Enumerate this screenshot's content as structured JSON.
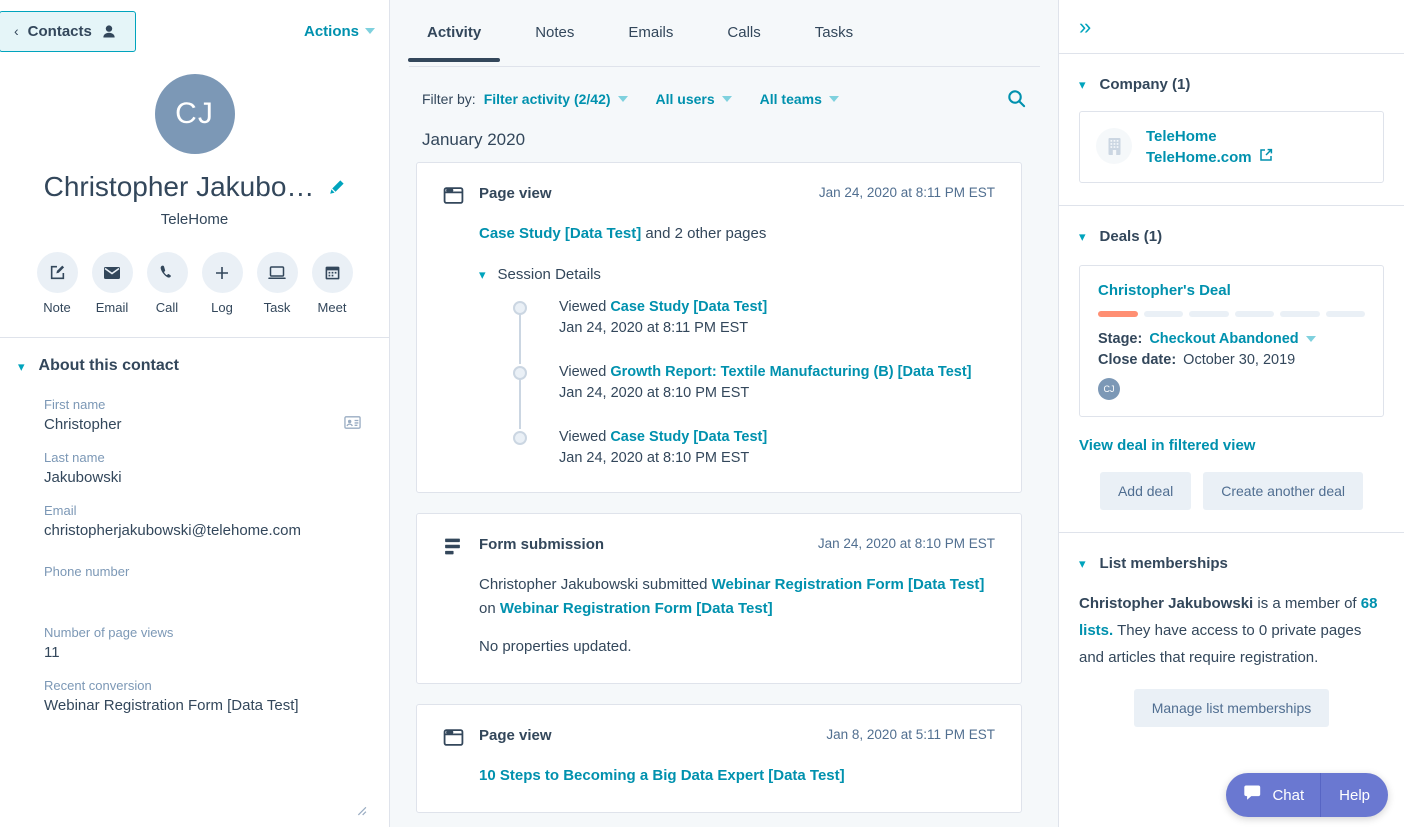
{
  "left": {
    "back_button": {
      "label": "Contacts",
      "chevron": "‹",
      "icon": "person-icon"
    },
    "actions": {
      "label": "Actions"
    },
    "profile": {
      "initials": "CJ",
      "name": "Christopher Jakubo…",
      "company": "TeleHome",
      "edit_icon": "pencil-icon"
    },
    "quick_actions": [
      {
        "label": "Note",
        "icon": "note-icon"
      },
      {
        "label": "Email",
        "icon": "email-icon"
      },
      {
        "label": "Call",
        "icon": "call-icon"
      },
      {
        "label": "Log",
        "icon": "plus-icon"
      },
      {
        "label": "Task",
        "icon": "task-icon"
      },
      {
        "label": "Meet",
        "icon": "calendar-icon"
      }
    ],
    "about": {
      "title": "About this contact",
      "properties": [
        {
          "label": "First name",
          "value": "Christopher"
        },
        {
          "label": "Last name",
          "value": "Jakubowski"
        },
        {
          "label": "Email",
          "value": "christopherjakubowski@telehome.com"
        },
        {
          "label": "Phone number",
          "value": ""
        },
        {
          "label": "Number of page views",
          "value": "11"
        },
        {
          "label": "Recent conversion",
          "value": "Webinar Registration Form [Data Test]"
        }
      ]
    }
  },
  "center": {
    "tabs": [
      {
        "label": "Activity",
        "active": true
      },
      {
        "label": "Notes",
        "active": false
      },
      {
        "label": "Emails",
        "active": false
      },
      {
        "label": "Calls",
        "active": false
      },
      {
        "label": "Tasks",
        "active": false
      }
    ],
    "filter": {
      "label": "Filter by:",
      "activity": "Filter activity (2/42)",
      "users": "All users",
      "teams": "All teams",
      "search_icon": "search-icon"
    },
    "month_heading": "January 2020",
    "cards": [
      {
        "icon": "page-view-icon",
        "title": "Page view",
        "date": "Jan 24, 2020 at 8:11 PM EST",
        "link_text": "Case Study [Data Test]",
        "trailing_text": " and 2 other pages",
        "session_toggle": "Session Details",
        "sessions": [
          {
            "prefix": "Viewed ",
            "link": "Case Study [Data Test]",
            "time": "Jan 24, 2020 at 8:11 PM EST"
          },
          {
            "prefix": "Viewed ",
            "link": "Growth Report: Textile Manufacturing (B) [Data Test]",
            "time": "Jan 24, 2020 at 8:10 PM EST"
          },
          {
            "prefix": "Viewed ",
            "link": "Case Study [Data Test]",
            "time": "Jan 24, 2020 at 8:10 PM EST"
          }
        ]
      },
      {
        "icon": "form-submission-icon",
        "title": "Form submission",
        "date": "Jan 24, 2020 at 8:10 PM EST",
        "body_prefix": "Christopher Jakubowski submitted ",
        "body_link1": "Webinar Registration Form [Data Test]",
        "body_mid": " on ",
        "body_link2": "Webinar Registration Form [Data Test]",
        "body_note": "No properties updated."
      },
      {
        "icon": "page-view-icon",
        "title": "Page view",
        "date": "Jan 8, 2020 at 5:11 PM EST",
        "link_text": "10 Steps to Becoming a Big Data Expert [Data Test]"
      }
    ]
  },
  "right": {
    "collapse_icon": "double-chevron-right-icon",
    "company": {
      "title": "Company (1)",
      "name": "TeleHome",
      "url": "TeleHome.com",
      "logo_icon": "building-icon",
      "external_icon": "external-link-icon"
    },
    "deals": {
      "title": "Deals (1)",
      "deal_name": "Christopher's Deal",
      "pipeline_total": 6,
      "pipeline_active": 1,
      "pipeline_active_color": "#ff8f73",
      "stage_label": "Stage:",
      "stage_value": "Checkout Abandoned",
      "close_label": "Close date:",
      "close_value": "October 30, 2019",
      "owner_initials": "CJ",
      "view_link": "View deal in filtered view",
      "add_button": "Add deal",
      "create_button": "Create another deal"
    },
    "lists": {
      "title": "List memberships",
      "text_name": "Christopher Jakubowski",
      "text_mid": " is a member of ",
      "text_link": "68 lists.",
      "text_tail": " They have access to 0 private pages and articles that require registration.",
      "manage_button": "Manage list memberships"
    }
  },
  "chat_widget": {
    "chat_label": "Chat",
    "help_label": "Help",
    "chat_icon": "chat-bubble-icon",
    "color": "#6a78d1"
  }
}
